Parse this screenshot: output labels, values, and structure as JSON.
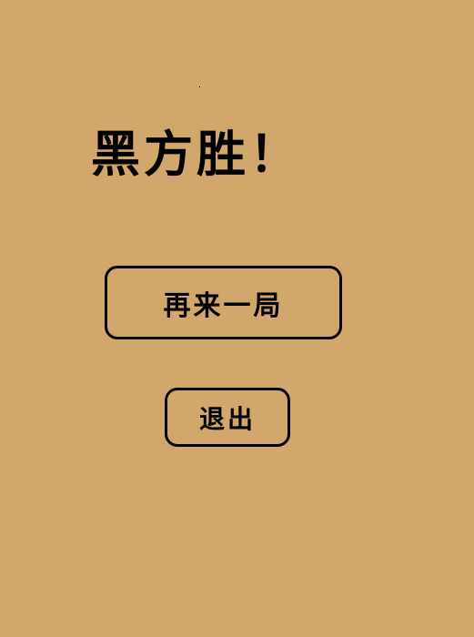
{
  "result": {
    "title": "黑方胜！"
  },
  "buttons": {
    "replay_label": "再来一局",
    "exit_label": "退出"
  },
  "colors": {
    "background": "#d2a76c",
    "text": "#000000",
    "border": "#000000"
  }
}
